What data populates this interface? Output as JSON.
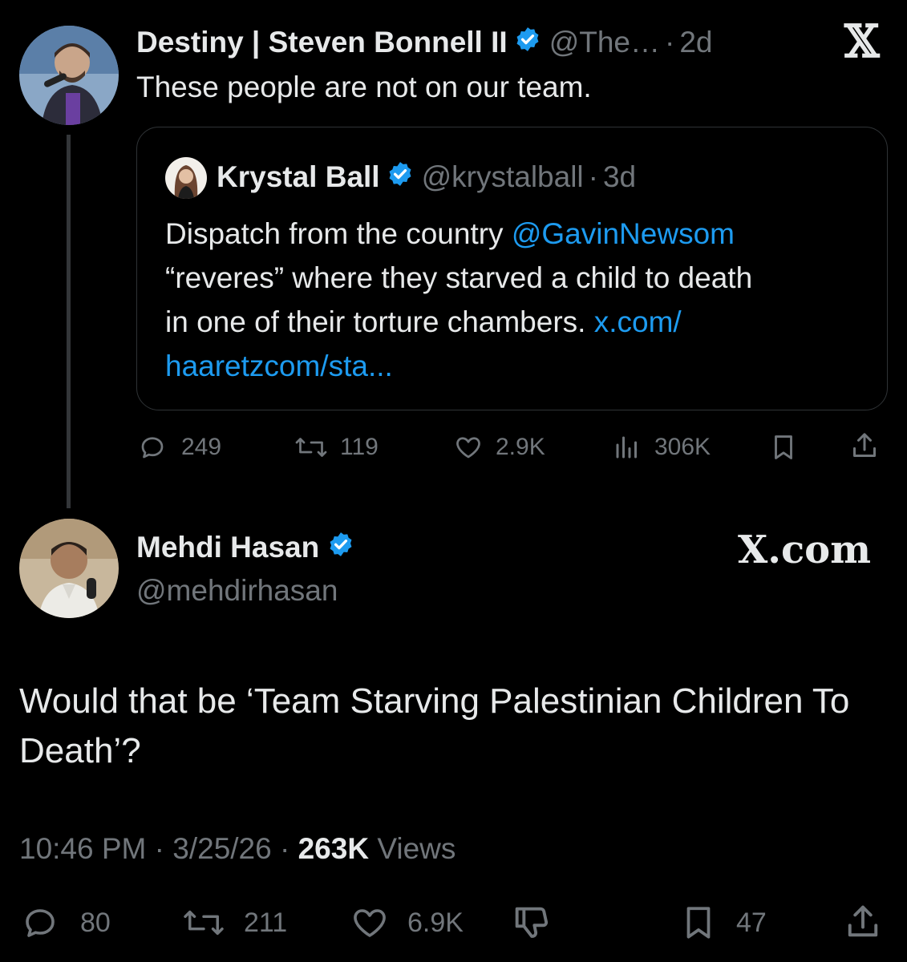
{
  "reply_to": {
    "author": {
      "name": "Destiny | Steven Bonnell II",
      "handle": "@The…",
      "time": "2d"
    },
    "text": "These people are not on our team.",
    "quoted": {
      "author": {
        "name": "Krystal Ball",
        "handle": "@krystalball",
        "time": "3d"
      },
      "text_line1_a": "Dispatch from the country ",
      "text_mention": "@GavinNewsom",
      "text_line2": "“reveres” where they starved a child to death",
      "text_line3_a": "in one of their torture chambers. ",
      "text_link1": "x.com/",
      "text_link2": "haaretzcom/sta..."
    },
    "stats": {
      "replies": "249",
      "reposts": "119",
      "likes": "2.9K",
      "views": "306K"
    },
    "platform_logo": "X"
  },
  "main": {
    "author": {
      "name": "Mehdi Hasan",
      "handle": "@mehdirhasan"
    },
    "brand": "X.com",
    "text": "Would that be ‘Team Starving Palestinian Children To Death’?",
    "time": "10:46 PM",
    "date": "3/25/26",
    "views_count": "263K",
    "views_label": "Views",
    "stats": {
      "replies": "80",
      "reposts": "211",
      "likes": "6.9K",
      "bookmarks": "47"
    }
  },
  "colors": {
    "background": "#000000",
    "text": "#e7e9ea",
    "muted": "#71767b",
    "link": "#1d9bf0",
    "verified": "#1d9bf0"
  },
  "icons": [
    "verified-icon",
    "x-logo-icon",
    "reply-icon",
    "repost-icon",
    "like-icon",
    "views-icon",
    "bookmark-icon",
    "share-icon",
    "dislike-icon"
  ]
}
